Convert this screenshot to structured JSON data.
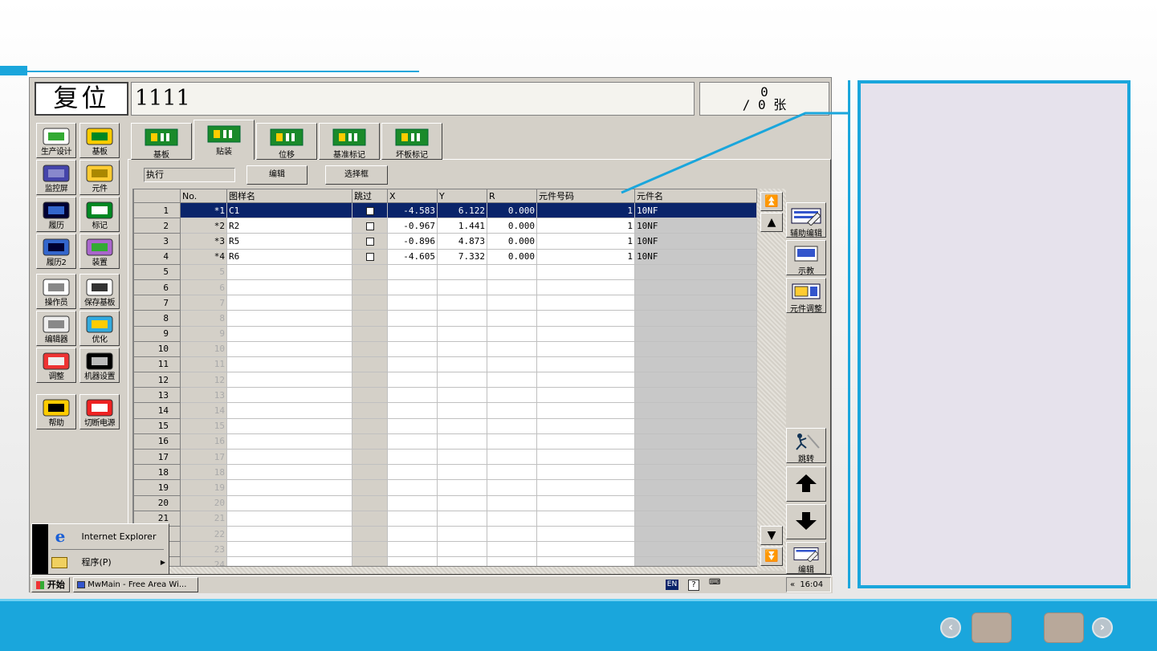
{
  "app": {
    "status": "复位",
    "program_name": "1111",
    "counter_top": "0",
    "counter_bottom": "/ 0 张"
  },
  "side_nav": [
    {
      "label": "生产设计",
      "icon": "production-design-icon"
    },
    {
      "label": "基板",
      "icon": "board-icon"
    },
    {
      "label": "监控屏",
      "icon": "monitor-icon"
    },
    {
      "label": "元件",
      "icon": "component-icon"
    },
    {
      "label": "履历",
      "icon": "history-icon"
    },
    {
      "label": "标记",
      "icon": "mark-icon"
    },
    {
      "label": "履历2",
      "icon": "history2-icon"
    },
    {
      "label": "装置",
      "icon": "device-icon"
    },
    {
      "label": "操作员",
      "icon": "operator-icon"
    },
    {
      "label": "保存基板",
      "icon": "save-board-icon"
    },
    {
      "label": "编辑器",
      "icon": "editor-icon"
    },
    {
      "label": "优化",
      "icon": "optimize-icon"
    },
    {
      "label": "调整",
      "icon": "adjust-icon"
    },
    {
      "label": "机器设置",
      "icon": "machine-settings-icon"
    },
    {
      "label": "帮助",
      "icon": "help-icon"
    },
    {
      "label": "切断电源",
      "icon": "power-off-icon"
    }
  ],
  "tabs": [
    {
      "label": "基板",
      "active": false
    },
    {
      "label": "贴装",
      "active": true
    },
    {
      "label": "位移",
      "active": false
    },
    {
      "label": "基准标记",
      "active": false
    },
    {
      "label": "坏板标记",
      "active": false
    }
  ],
  "toolbar": {
    "filter_value": "执行",
    "edit_label": "编辑",
    "select_frame_label": "选择框"
  },
  "table": {
    "headers": [
      "No.",
      "图样名",
      "跳过",
      "X",
      "Y",
      "R",
      "元件号码",
      "元件名"
    ],
    "rows": [
      {
        "n": "1",
        "no": "*1",
        "pattern": "C1",
        "x": "-4.583",
        "y": "6.122",
        "r": "0.000",
        "part_no": "1",
        "part_name": "10NF"
      },
      {
        "n": "2",
        "no": "*2",
        "pattern": "R2",
        "x": "-0.967",
        "y": "1.441",
        "r": "0.000",
        "part_no": "1",
        "part_name": "10NF"
      },
      {
        "n": "3",
        "no": "*3",
        "pattern": "R5",
        "x": "-0.896",
        "y": "4.873",
        "r": "0.000",
        "part_no": "1",
        "part_name": "10NF"
      },
      {
        "n": "4",
        "no": "*4",
        "pattern": "R6",
        "x": "-4.605",
        "y": "7.332",
        "r": "0.000",
        "part_no": "1",
        "part_name": "10NF"
      },
      {
        "n": "5",
        "no": "5"
      },
      {
        "n": "6",
        "no": "6"
      },
      {
        "n": "7",
        "no": "7"
      },
      {
        "n": "8",
        "no": "8"
      },
      {
        "n": "9",
        "no": "9"
      },
      {
        "n": "10",
        "no": "10"
      },
      {
        "n": "11",
        "no": "11"
      },
      {
        "n": "12",
        "no": "12"
      },
      {
        "n": "13",
        "no": "13"
      },
      {
        "n": "14",
        "no": "14"
      },
      {
        "n": "15",
        "no": "15"
      },
      {
        "n": "16",
        "no": "16"
      },
      {
        "n": "17",
        "no": "17"
      },
      {
        "n": "18",
        "no": "18"
      },
      {
        "n": "19",
        "no": "19"
      },
      {
        "n": "20",
        "no": "20"
      },
      {
        "n": "21",
        "no": "21"
      },
      {
        "n": "22",
        "no": "22"
      },
      {
        "n": "23",
        "no": "23"
      },
      {
        "n": "24",
        "no": "24"
      }
    ]
  },
  "right_buttons": {
    "aux_edit": "辅助编辑",
    "teach": "示教",
    "part_adjust": "元件调整",
    "jump": "跳转",
    "edit": "编辑"
  },
  "start_menu": {
    "item1": "Internet Explorer",
    "item2": "程序(P)"
  },
  "taskbar": {
    "start_label": "开始",
    "task_label": "MwMain - Free Area Wi...",
    "lang": "EN",
    "help": "?",
    "clock": "16:04"
  },
  "colors": {
    "accent": "#1aa6dc",
    "selection": "#0a246a",
    "panel_bg": "#e6e2ec"
  }
}
